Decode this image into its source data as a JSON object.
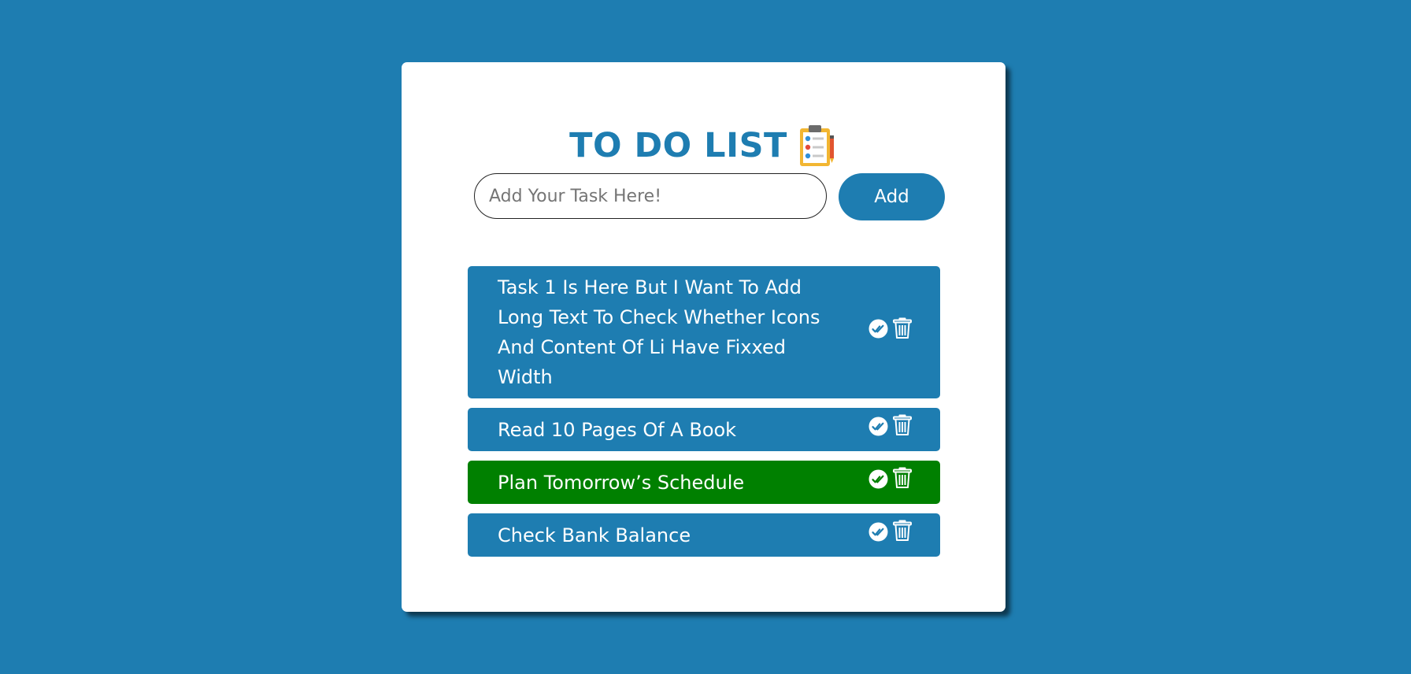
{
  "app": {
    "title": "TO DO LIST",
    "title_icon": "clipboard-checklist-icon",
    "accent_color": "#1e7db1",
    "completed_color": "#008000",
    "background_color": "#1e7db1"
  },
  "input": {
    "placeholder": "Add Your Task Here!",
    "value": ""
  },
  "add_button": {
    "label": "Add"
  },
  "tasks": [
    {
      "text": "Task 1 Is Here But I Want To Add Long Text To Check Whether Icons And Content Of Li Have Fixxed Width",
      "completed": false,
      "check_icon": "double-check-icon",
      "delete_icon": "trash-icon"
    },
    {
      "text": "Read 10 Pages Of A Book",
      "completed": false,
      "check_icon": "double-check-icon",
      "delete_icon": "trash-icon"
    },
    {
      "text": "Plan Tomorrow’s Schedule",
      "completed": true,
      "check_icon": "double-check-icon",
      "delete_icon": "trash-icon"
    },
    {
      "text": "Check Bank Balance",
      "completed": false,
      "check_icon": "double-check-icon",
      "delete_icon": "trash-icon"
    }
  ]
}
